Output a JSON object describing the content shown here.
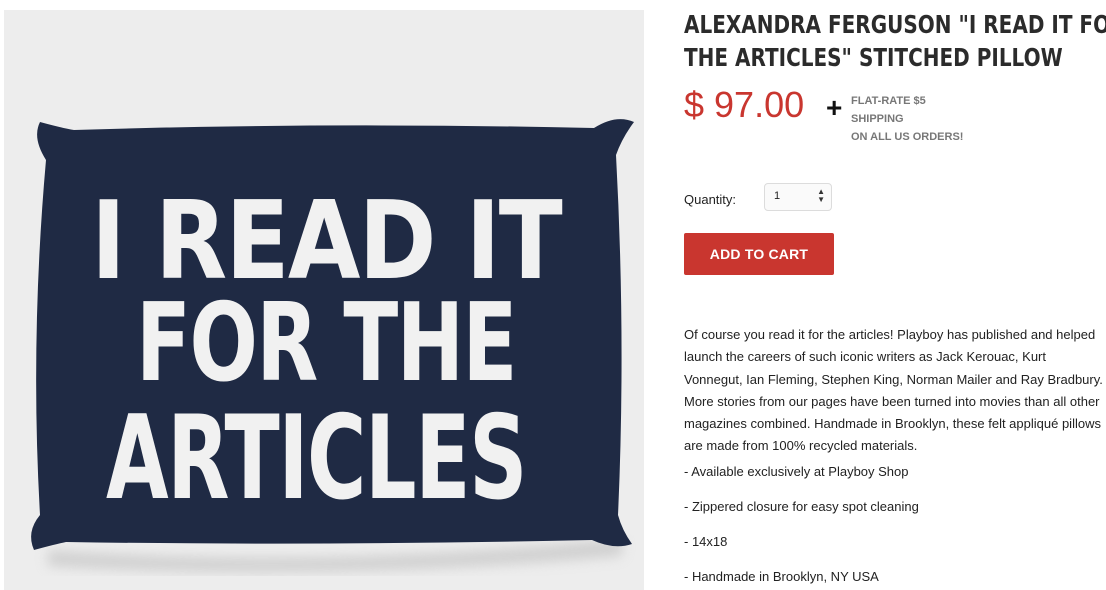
{
  "product": {
    "title_lines": [
      "ALEXANDRA FERGUSON \"I READ IT FOR",
      "THE ARTICLES\" STITCHED PILLOW"
    ],
    "price": "$ 97.00",
    "plus": "+",
    "shipping_lines": [
      "FLAT-RATE $5",
      "SHIPPING",
      "ON ALL US ORDERS!"
    ],
    "quantity_label": "Quantity:",
    "quantity_value": "1",
    "add_to_cart": "ADD TO CART",
    "description": "Of course you read it for the articles! Playboy has published and helped launch the careers of such iconic writers as Jack Kerouac, Kurt Vonnegut, Ian Fleming, Stephen King, Norman Mailer and Ray Bradbury. More stories from our pages have been turned into movies than all other magazines combined. Handmade in Brooklyn, these felt appliqué pillows are made from 100% recycled materials.",
    "bullets": [
      "- Available exclusively at Playboy Shop",
      "- Zippered closure for easy spot cleaning",
      "- 14x18",
      "- Handmade in Brooklyn, NY USA"
    ]
  },
  "image": {
    "lines": [
      "I READ IT",
      "FOR THE",
      "ARTICLES"
    ],
    "pillow_color": "#1f2a44",
    "letter_color": "#f1f1f1",
    "background": "#ededed"
  },
  "colors": {
    "accent": "#c9362f",
    "shipping_text": "#777777"
  }
}
